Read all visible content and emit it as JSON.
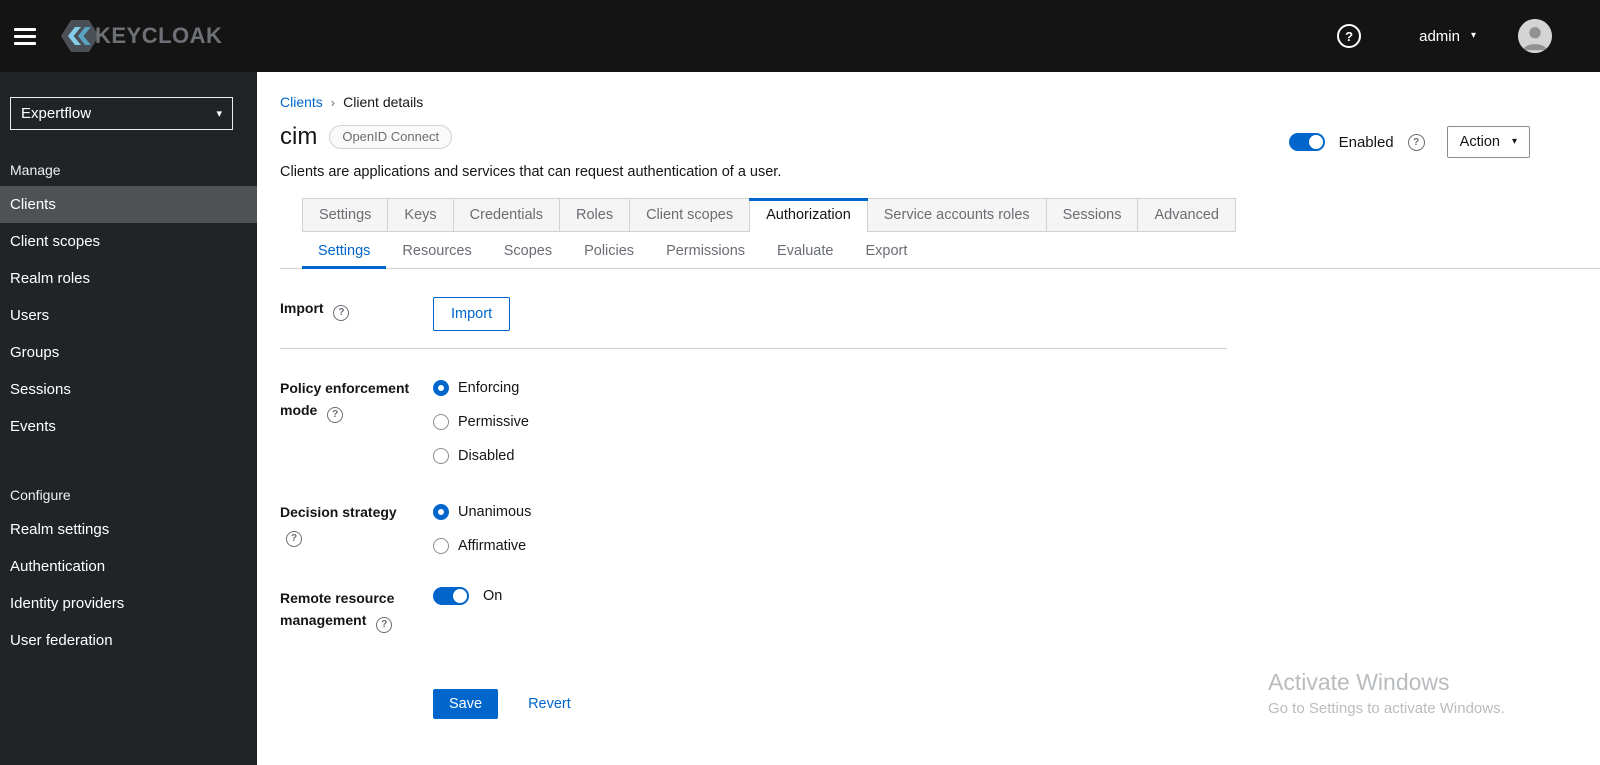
{
  "icons": {
    "question_mark": "?",
    "caret_down": "▾",
    "breadcrumb_separator": "›"
  },
  "topbar": {
    "brand": "KEYCLOAK",
    "user": "admin"
  },
  "sidebar": {
    "realm": "Expertflow",
    "sections": [
      {
        "title": "Manage",
        "items": [
          "Clients",
          "Client scopes",
          "Realm roles",
          "Users",
          "Groups",
          "Sessions",
          "Events"
        ],
        "active_item": "Clients"
      },
      {
        "title": "Configure",
        "items": [
          "Realm settings",
          "Authentication",
          "Identity providers",
          "User federation"
        ]
      }
    ]
  },
  "main": {
    "breadcrumb": [
      "Clients",
      "Client details"
    ],
    "header": {
      "title": "cim",
      "badge": "OpenID Connect",
      "enabled_label": "Enabled",
      "enabled_state": true,
      "action_label": "Action",
      "description": "Clients are applications and services that can request authentication of a user."
    },
    "tabs": [
      "Settings",
      "Keys",
      "Credentials",
      "Roles",
      "Client scopes",
      "Authorization",
      "Service accounts roles",
      "Sessions",
      "Advanced"
    ],
    "active_tab": "Authorization",
    "subtabs": [
      "Settings",
      "Resources",
      "Scopes",
      "Policies",
      "Permissions",
      "Evaluate",
      "Export"
    ],
    "active_subtab": "Settings",
    "form": {
      "import": {
        "label": "Import",
        "button_label": "Import"
      },
      "policy_enforcement_mode": {
        "label": "Policy enforcement mode",
        "options": [
          "Enforcing",
          "Permissive",
          "Disabled"
        ],
        "selected": "Enforcing"
      },
      "decision_strategy": {
        "label": "Decision strategy",
        "options": [
          "Unanimous",
          "Affirmative"
        ],
        "selected": "Unanimous"
      },
      "remote_resource_management": {
        "label": "Remote resource management",
        "state": "On",
        "enabled": true
      },
      "save_label": "Save",
      "revert_label": "Revert"
    },
    "watermark": {
      "title": "Activate Windows",
      "subtitle": "Go to Settings to activate Windows."
    }
  },
  "colors": {
    "accent_blue": "#0066cc",
    "masthead_bg": "#141414",
    "sidebar_bg": "#212427",
    "sidebar_active_bg": "#4f5255",
    "border_gray": "#d2d2d2",
    "muted_text": "#6a6e73"
  }
}
